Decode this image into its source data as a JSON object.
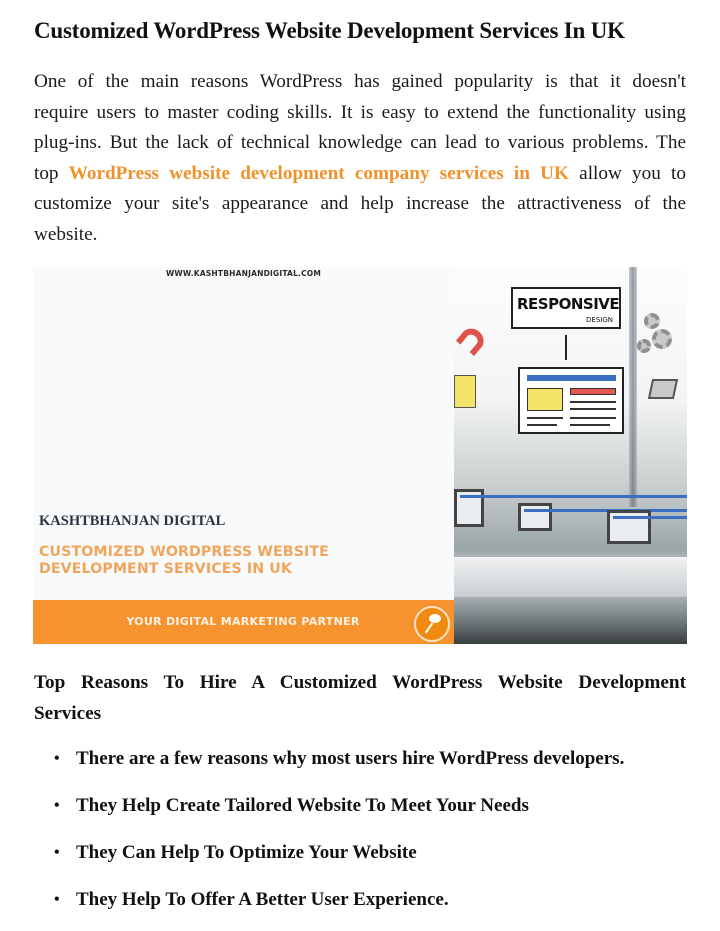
{
  "title": "Customized WordPress Website Development Services In UK",
  "intro": {
    "before_link": "One of the main reasons WordPress has gained popularity is that it doesn't require users to master coding skills. It is easy to extend the functionality using plug-ins. But the lack of technical knowledge can lead to various problems. The top ",
    "link_text": "WordPress website development company services in UK",
    "after_link": " allow you to customize your site's appearance and help increase the attractiveness of the website."
  },
  "banner": {
    "url": "WWW.KASHTBHANJANDIGITAL.COM",
    "brand": "KASHTBHANJAN DIGITAL",
    "headline_line1": "CUSTOMIZED WORDPRESS WEBSITE",
    "headline_line2": "DEVELOPMENT SERVICES IN UK",
    "tagline": "YOUR DIGITAL MARKETING PARTNER",
    "illustration_title": "RESPONSIVE",
    "illustration_subtitle": "DESIGN",
    "accent_color": "#f7932e"
  },
  "section": {
    "heading": "Top Reasons To Hire A Customized WordPress Website Development Services",
    "bullets": [
      "There are a few reasons why most users hire WordPress developers.",
      "They Help Create Tailored Website To Meet Your Needs",
      "They Can Help To Optimize Your Website",
      "They Help To Offer A Better User Experience."
    ]
  },
  "colors": {
    "link": "#f0922b",
    "text": "#111111"
  }
}
